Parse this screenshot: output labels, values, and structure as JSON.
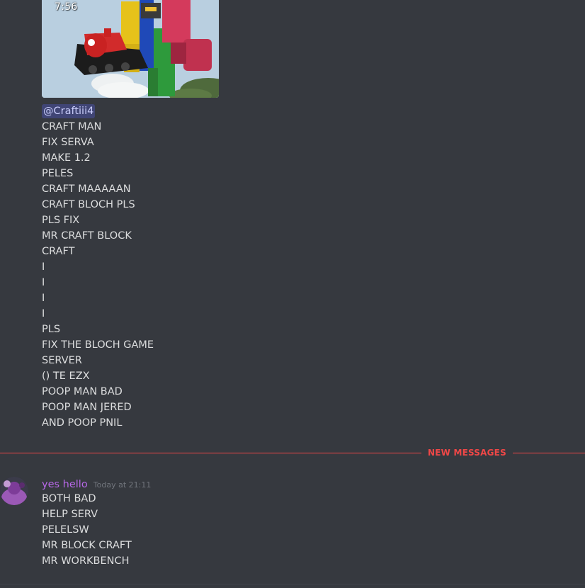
{
  "video": {
    "duration": "7:56"
  },
  "previous_message": {
    "mention": "@Craftiii4",
    "lines": [
      "CRAFT MAN",
      "FIX SERVA",
      "MAKE 1.2",
      "PELES",
      "CRAFT MAAAAAN",
      "CRAFT BLOCH PLS",
      "PLS FIX",
      "MR CRAFT BLOCK",
      "CRAFT",
      "I",
      "I",
      "I",
      "I",
      "PLS",
      "FIX THE BLOCH GAME",
      "SERVER",
      "() TE EZX",
      "POOP MAN BAD",
      "POOP MAN JERED",
      "AND POOP PNIL"
    ]
  },
  "divider": {
    "label": "NEW MESSAGES",
    "color": "#f04747"
  },
  "new_message": {
    "username": "yes hello",
    "username_color": "#b768e8",
    "timestamp": "Today at 21:11",
    "avatar_icon": "user-avatar",
    "lines": [
      "BOTH BAD",
      "HELP SERV",
      "PELELSW",
      "MR BLOCK CRAFT",
      "MR WORKBENCH"
    ]
  },
  "colors": {
    "background": "#36393f",
    "text": "#dcddde",
    "mention_bg": "#414675",
    "timestamp": "#72767d"
  }
}
